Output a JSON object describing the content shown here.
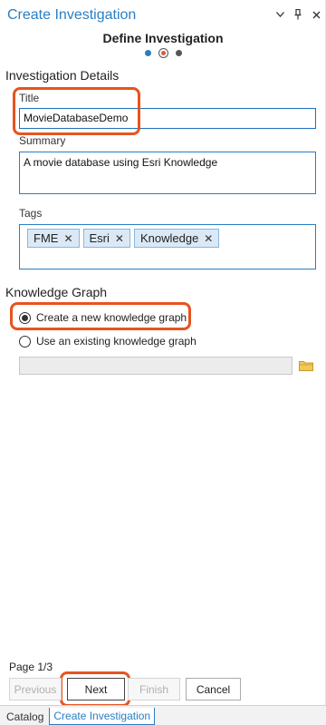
{
  "header": {
    "title": "Create Investigation",
    "menu_icon": "chevron-down-icon",
    "pin_icon": "pin-icon",
    "close_icon": "close-icon"
  },
  "wizard": {
    "step_title": "Define Investigation",
    "steps": 3,
    "current_step": 2
  },
  "details": {
    "heading": "Investigation Details",
    "title_label": "Title",
    "title_value": "MovieDatabaseDemo",
    "summary_label": "Summary",
    "summary_value": "A movie database using Esri Knowledge",
    "tags_label": "Tags",
    "tags": [
      "FME",
      "Esri",
      "Knowledge"
    ],
    "tag_remove_glyph": "✕"
  },
  "kg": {
    "heading": "Knowledge Graph",
    "option_new": "Create a new knowledge graph",
    "option_existing": "Use an existing knowledge graph",
    "selected": "new",
    "path_value": ""
  },
  "footer": {
    "page_indicator": "Page 1/3",
    "previous": "Previous",
    "next": "Next",
    "finish": "Finish",
    "cancel": "Cancel"
  },
  "tabs": [
    "Catalog",
    "Create Investigation"
  ],
  "colors": {
    "accent": "#2a7ec3",
    "highlight": "#e8531f"
  }
}
